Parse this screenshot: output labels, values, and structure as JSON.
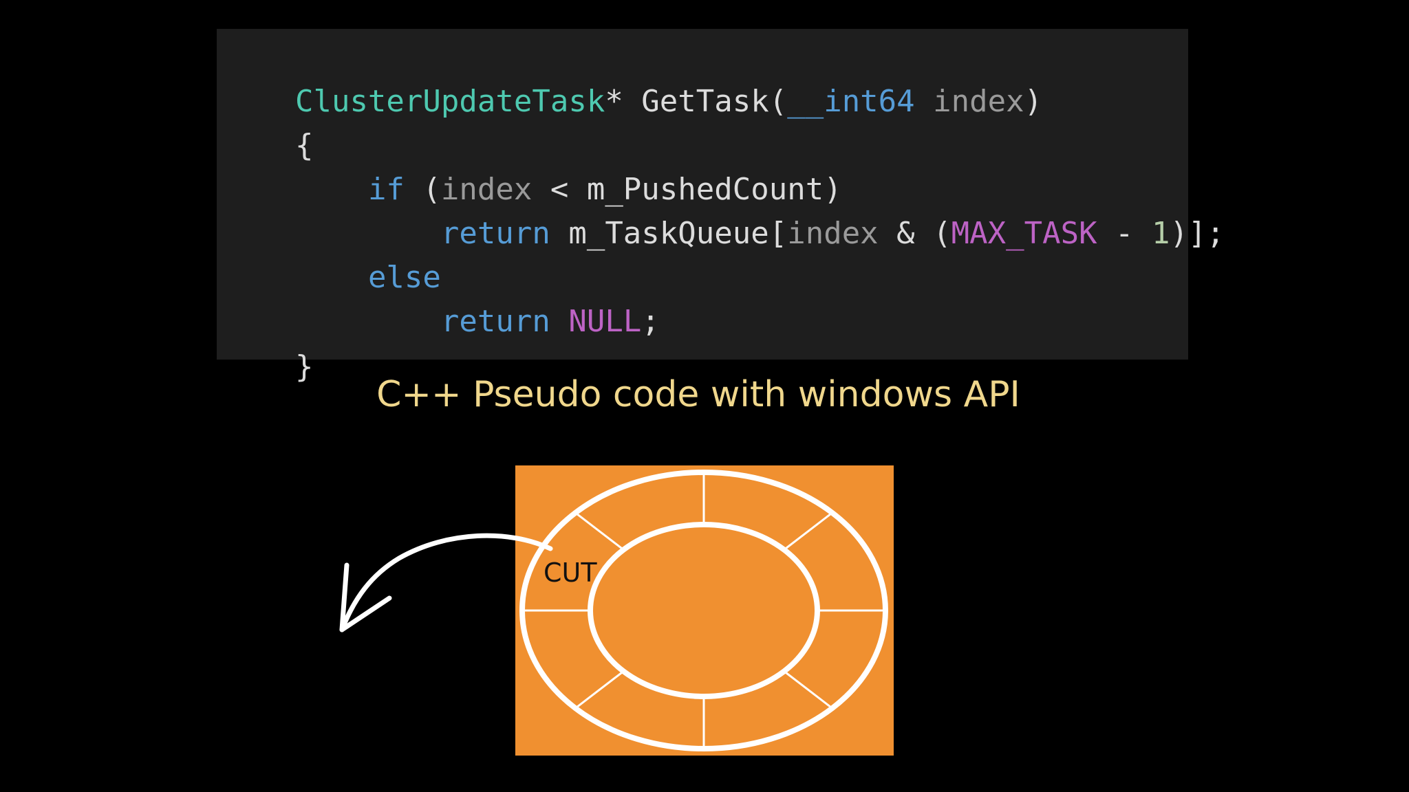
{
  "code": {
    "lines": [
      {
        "tokens": [
          {
            "text": "ClusterUpdateTask",
            "role": "type"
          },
          {
            "text": "* GetTask(",
            "role": "func"
          },
          {
            "text": "__int64",
            "role": "kw"
          },
          {
            "text": " index",
            "role": "param"
          },
          {
            "text": ")",
            "role": "punct"
          }
        ]
      },
      {
        "tokens": [
          {
            "text": "{",
            "role": "punct"
          }
        ]
      },
      {
        "tokens": [
          {
            "text": "    ",
            "role": "punct"
          },
          {
            "text": "if",
            "role": "kw"
          },
          {
            "text": " (",
            "role": "punct"
          },
          {
            "text": "index",
            "role": "param"
          },
          {
            "text": " < m_PushedCount)",
            "role": "punct"
          }
        ]
      },
      {
        "tokens": [
          {
            "text": "        ",
            "role": "punct"
          },
          {
            "text": "return",
            "role": "kw"
          },
          {
            "text": " m_TaskQueue[",
            "role": "punct"
          },
          {
            "text": "index",
            "role": "param"
          },
          {
            "text": " & (",
            "role": "punct"
          },
          {
            "text": "MAX_TASK",
            "role": "macro"
          },
          {
            "text": " - ",
            "role": "punct"
          },
          {
            "text": "1",
            "role": "num"
          },
          {
            "text": ")];",
            "role": "punct"
          }
        ]
      },
      {
        "tokens": [
          {
            "text": "    ",
            "role": "punct"
          },
          {
            "text": "else",
            "role": "kw"
          }
        ]
      },
      {
        "tokens": [
          {
            "text": "        ",
            "role": "punct"
          },
          {
            "text": "return",
            "role": "kw"
          },
          {
            "text": " ",
            "role": "punct"
          },
          {
            "text": "NULL",
            "role": "macro"
          },
          {
            "text": ";",
            "role": "punct"
          }
        ]
      },
      {
        "tokens": [
          {
            "text": "}",
            "role": "punct"
          }
        ]
      }
    ]
  },
  "caption": "C++ Pseudo code with windows API",
  "diagram": {
    "label": "CUT",
    "segments": 8
  },
  "colors": {
    "background": "#000000",
    "code_bg": "#1e1e1e",
    "caption": "#f0d78c",
    "diagram_bg": "#f09030",
    "ring_stroke": "#ffffff",
    "arrow": "#ffffff"
  }
}
